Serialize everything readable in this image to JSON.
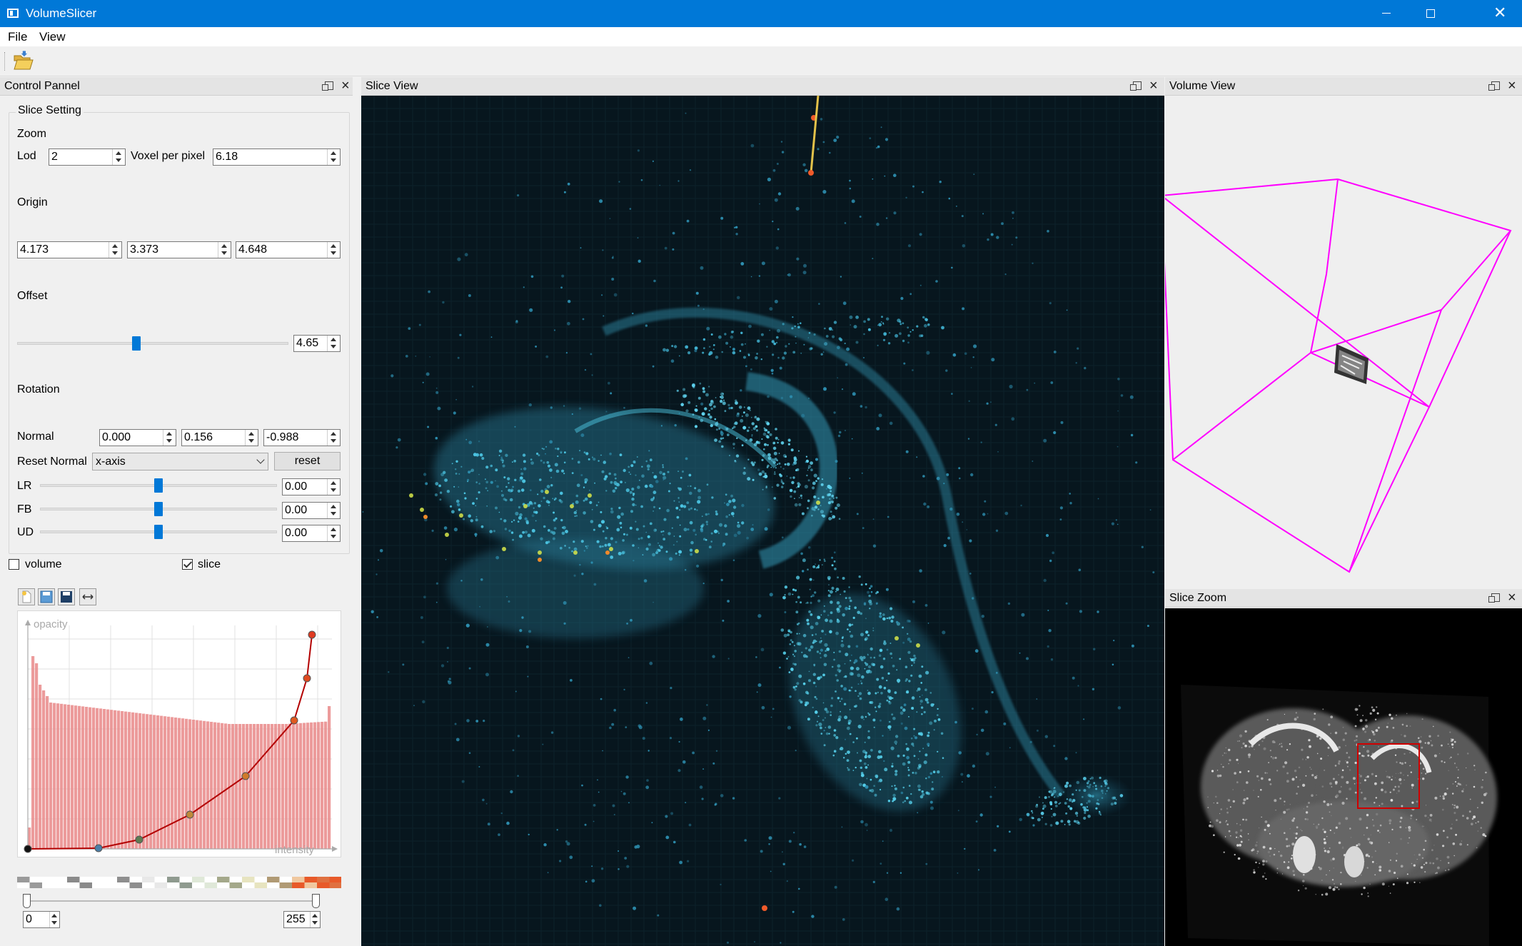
{
  "window": {
    "title": "VolumeSlicer",
    "app_icon": "window-app-icon"
  },
  "menu": {
    "file": "File",
    "view": "View"
  },
  "toolbar": {
    "open_icon": "folder-open-icon"
  },
  "docks": {
    "control": "Control Pannel",
    "slice_view": "Slice View",
    "volume_view": "Volume View",
    "slice_zoom": "Slice Zoom"
  },
  "slice_setting": {
    "title": "Slice Setting",
    "zoom_label": "Zoom",
    "lod_label": "Lod",
    "lod_value": "2",
    "vpp_label": "Voxel per pixel",
    "vpp_value": "6.18",
    "origin_label": "Origin",
    "origin": [
      "4.173",
      "3.373",
      "4.648"
    ],
    "offset_label": "Offset",
    "offset_value": "4.65",
    "offset_fraction": 0.44,
    "rotation_label": "Rotation",
    "normal_label": "Normal",
    "normal": [
      "0.000",
      "0.156",
      "-0.988"
    ],
    "reset_normal_label": "Reset Normal",
    "reset_normal_selected": "x-axis",
    "reset_button": "reset",
    "lr_label": "LR",
    "lr_value": "0.00",
    "fb_label": "FB",
    "fb_value": "0.00",
    "ud_label": "UD",
    "ud_value": "0.00",
    "rot_slider_fraction": 0.5
  },
  "toggles": {
    "volume_label": "volume",
    "volume_checked": false,
    "slice_label": "slice",
    "slice_checked": true
  },
  "transfer_function": {
    "buttons": [
      "new-file-icon",
      "save-icon",
      "save-as-icon",
      "fit-range-icon"
    ],
    "y_axis_label": "opacity",
    "x_axis_label": "intensity",
    "range_min": "0",
    "range_max": "255"
  },
  "colors": {
    "accent": "#0078d7",
    "bbox": "#ff00ff",
    "histogram": "#e98a8a",
    "curve": "#b30000"
  }
}
